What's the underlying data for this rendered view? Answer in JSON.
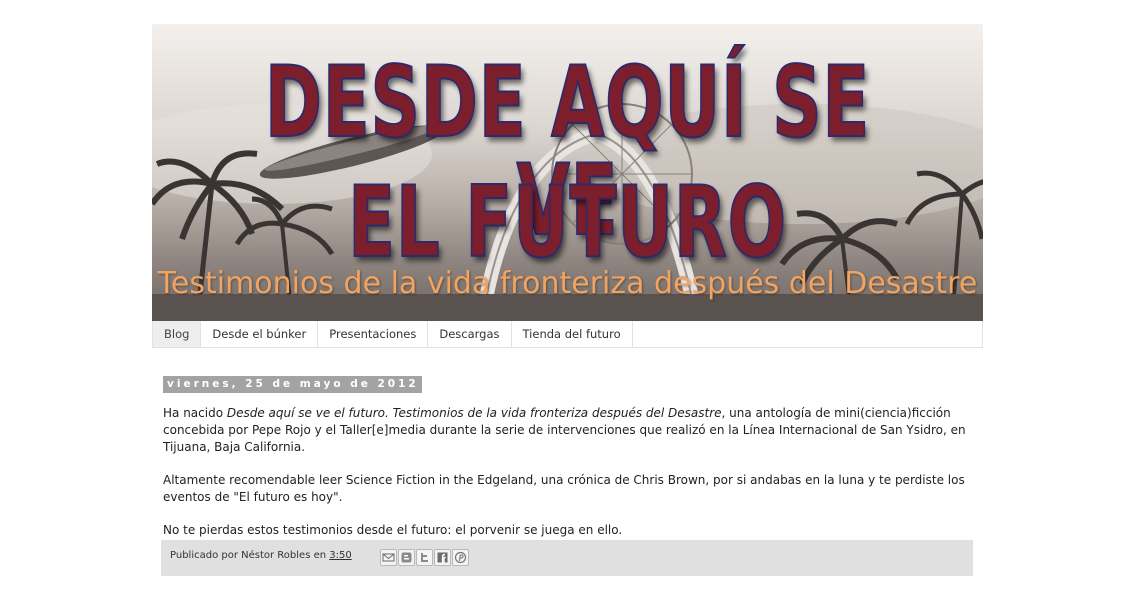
{
  "header": {
    "title_line1": "DESDE AQUÍ SE VE",
    "title_line2": "EL FUTURO",
    "subtitle": "Testimonios de la vida fronteriza después del Desastre"
  },
  "tabs": [
    {
      "label": "Blog",
      "active": true
    },
    {
      "label": "Desde el búnker",
      "active": false
    },
    {
      "label": "Presentaciones",
      "active": false
    },
    {
      "label": "Descargas",
      "active": false
    },
    {
      "label": "Tienda del futuro",
      "active": false
    }
  ],
  "post": {
    "date": "viernes, 25 de mayo de 2012",
    "p1_a": "Ha nacido ",
    "p1_italic": "Desde aquí se ve el futuro. Testimonios de la vida fronteriza después del Desastre",
    "p1_b": ", una antología de mini(ciencia)ficción concebida por Pepe Rojo y el Taller[e]media durante la serie de intervenciones que realizó en la Línea Internacional de San Ysidro, en Tijuana, Baja California.",
    "p2": "Altamente recomendable leer Science Fiction in the Edgeland, una crónica de Chris Brown, por si andabas en la luna y te perdiste los eventos de \"El futuro es hoy\".",
    "p3": "No te pierdas estos testimonios desde el futuro: el porvenir se juega en ello."
  },
  "footer": {
    "published_by": "Publicado por Néstor Robles en ",
    "time": "3:50",
    "share_icons": [
      "email-icon",
      "blogger-icon",
      "twitter-icon",
      "facebook-icon",
      "pinterest-icon"
    ]
  },
  "colors": {
    "title_fill": "#7d1e2c",
    "title_stroke": "#2c2a6a",
    "subtitle": "#f3a360",
    "date_bg": "#a3a3a3",
    "footer_bg": "#e0e0e0"
  }
}
